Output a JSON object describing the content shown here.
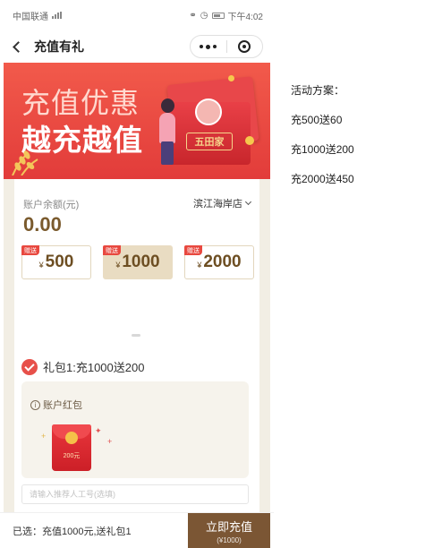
{
  "statusbar": {
    "carrier": "中国联通",
    "time": "下午4:02"
  },
  "navbar": {
    "title": "充值有礼"
  },
  "banner": {
    "line1": "充值优惠",
    "line2": "越充越值",
    "brand": "五田家"
  },
  "account": {
    "balance_label": "账户余额(元)",
    "balance": "0.00",
    "store": "滨江海岸店"
  },
  "amounts": [
    {
      "currency": "¥",
      "value": "500",
      "tag": "赠送",
      "selected": false
    },
    {
      "currency": "¥",
      "value": "1000",
      "tag": "赠送",
      "selected": true
    },
    {
      "currency": "¥",
      "value": "2000",
      "tag": "赠送",
      "selected": false
    }
  ],
  "package": {
    "label": "礼包1:充1000送200"
  },
  "gift": {
    "title": "账户红包",
    "redpack_amount": "200元"
  },
  "referral": {
    "placeholder": "请输入推荐人工号(选填)"
  },
  "bottom": {
    "selected_text": "已选：充值1000元,送礼包1",
    "pay_label": "立即充值",
    "pay_amount": "(¥1000)"
  },
  "notes": {
    "heading": "活动方案：",
    "items": [
      "充500送60",
      "充1000送200",
      "充2000送450"
    ]
  },
  "colors": {
    "banner_red": "#e23c3a",
    "accent_brown": "#7b5634",
    "selected_bg": "#e9dcc2",
    "check_red": "#e7504a"
  }
}
